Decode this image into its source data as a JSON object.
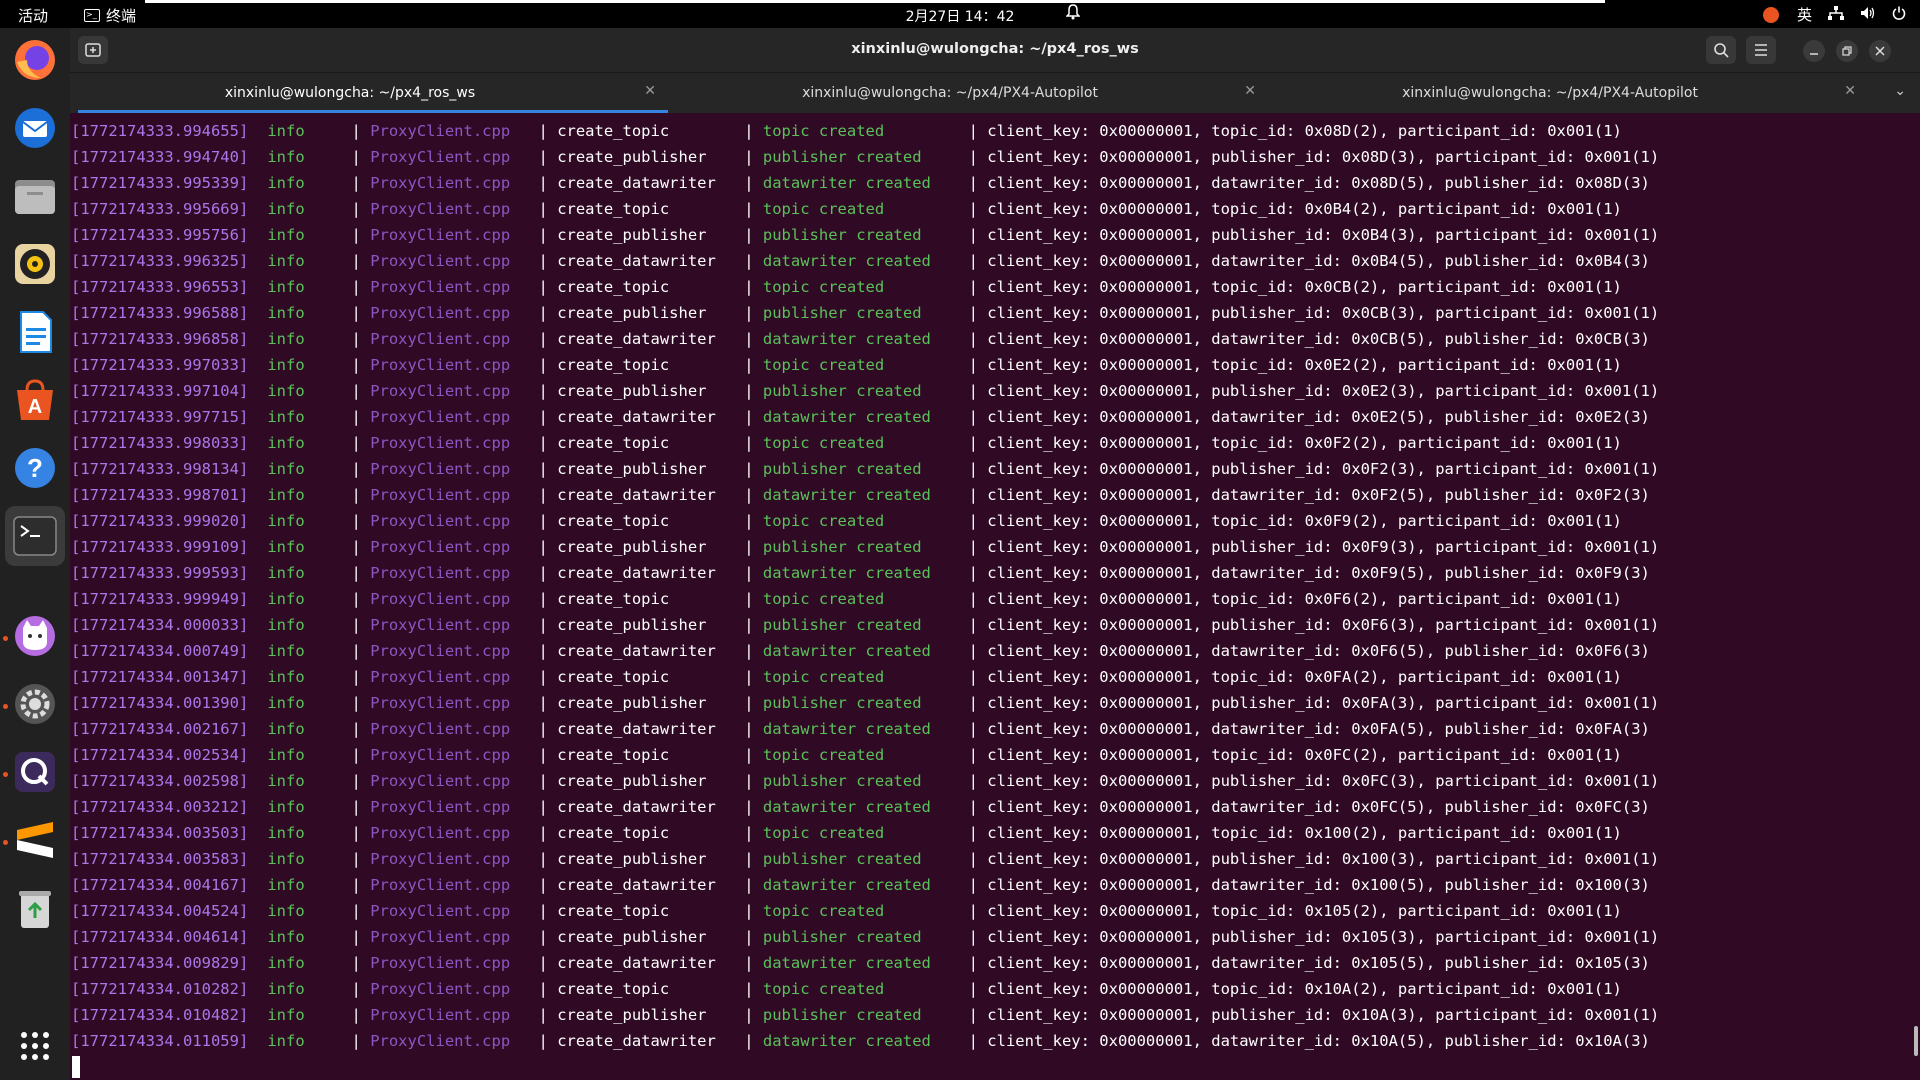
{
  "topbar": {
    "activities": "活动",
    "app_name": "终端",
    "clock": "2月27日 14：42",
    "input_method": "英"
  },
  "window": {
    "title": "xinxinlu@wulongcha: ~/px4_ros_ws",
    "tabs": [
      {
        "label": "xinxinlu@wulongcha: ~/px4_ros_ws",
        "active": true
      },
      {
        "label": "xinxinlu@wulongcha: ~/px4/PX4-Autopilot",
        "active": false
      },
      {
        "label": "xinxinlu@wulongcha: ~/px4/PX4-Autopilot",
        "active": false
      }
    ]
  },
  "dock": {
    "items": [
      "firefox-icon",
      "thunderbird-icon",
      "files-icon",
      "rhythmbox-icon",
      "libreoffice-writer-icon",
      "app-center-icon",
      "help-icon",
      "terminal-icon",
      "cat-app-icon",
      "settings-icon",
      "qgroundcontrol-icon",
      "sublime-text-icon",
      "trash-icon",
      "show-apps-icon"
    ]
  },
  "colors": {
    "terminal_bg": "#300a24",
    "timestamp": "#ab76ea",
    "level": "#5ac15a",
    "file": "#8e55c4",
    "accent": "#3584e4"
  },
  "log": [
    {
      "ts": "[1772174333.994655]",
      "level": "info",
      "file": "ProxyClient.cpp",
      "func": "create_topic",
      "status": "topic created",
      "details": "client_key: 0x00000001, topic_id: 0x08D(2), participant_id: 0x001(1)"
    },
    {
      "ts": "[1772174333.994740]",
      "level": "info",
      "file": "ProxyClient.cpp",
      "func": "create_publisher",
      "status": "publisher created",
      "details": "client_key: 0x00000001, publisher_id: 0x08D(3), participant_id: 0x001(1)"
    },
    {
      "ts": "[1772174333.995339]",
      "level": "info",
      "file": "ProxyClient.cpp",
      "func": "create_datawriter",
      "status": "datawriter created",
      "details": "client_key: 0x00000001, datawriter_id: 0x08D(5), publisher_id: 0x08D(3)"
    },
    {
      "ts": "[1772174333.995669]",
      "level": "info",
      "file": "ProxyClient.cpp",
      "func": "create_topic",
      "status": "topic created",
      "details": "client_key: 0x00000001, topic_id: 0x0B4(2), participant_id: 0x001(1)"
    },
    {
      "ts": "[1772174333.995756]",
      "level": "info",
      "file": "ProxyClient.cpp",
      "func": "create_publisher",
      "status": "publisher created",
      "details": "client_key: 0x00000001, publisher_id: 0x0B4(3), participant_id: 0x001(1)"
    },
    {
      "ts": "[1772174333.996325]",
      "level": "info",
      "file": "ProxyClient.cpp",
      "func": "create_datawriter",
      "status": "datawriter created",
      "details": "client_key: 0x00000001, datawriter_id: 0x0B4(5), publisher_id: 0x0B4(3)"
    },
    {
      "ts": "[1772174333.996553]",
      "level": "info",
      "file": "ProxyClient.cpp",
      "func": "create_topic",
      "status": "topic created",
      "details": "client_key: 0x00000001, topic_id: 0x0CB(2), participant_id: 0x001(1)"
    },
    {
      "ts": "[1772174333.996588]",
      "level": "info",
      "file": "ProxyClient.cpp",
      "func": "create_publisher",
      "status": "publisher created",
      "details": "client_key: 0x00000001, publisher_id: 0x0CB(3), participant_id: 0x001(1)"
    },
    {
      "ts": "[1772174333.996858]",
      "level": "info",
      "file": "ProxyClient.cpp",
      "func": "create_datawriter",
      "status": "datawriter created",
      "details": "client_key: 0x00000001, datawriter_id: 0x0CB(5), publisher_id: 0x0CB(3)"
    },
    {
      "ts": "[1772174333.997033]",
      "level": "info",
      "file": "ProxyClient.cpp",
      "func": "create_topic",
      "status": "topic created",
      "details": "client_key: 0x00000001, topic_id: 0x0E2(2), participant_id: 0x001(1)"
    },
    {
      "ts": "[1772174333.997104]",
      "level": "info",
      "file": "ProxyClient.cpp",
      "func": "create_publisher",
      "status": "publisher created",
      "details": "client_key: 0x00000001, publisher_id: 0x0E2(3), participant_id: 0x001(1)"
    },
    {
      "ts": "[1772174333.997715]",
      "level": "info",
      "file": "ProxyClient.cpp",
      "func": "create_datawriter",
      "status": "datawriter created",
      "details": "client_key: 0x00000001, datawriter_id: 0x0E2(5), publisher_id: 0x0E2(3)"
    },
    {
      "ts": "[1772174333.998033]",
      "level": "info",
      "file": "ProxyClient.cpp",
      "func": "create_topic",
      "status": "topic created",
      "details": "client_key: 0x00000001, topic_id: 0x0F2(2), participant_id: 0x001(1)"
    },
    {
      "ts": "[1772174333.998134]",
      "level": "info",
      "file": "ProxyClient.cpp",
      "func": "create_publisher",
      "status": "publisher created",
      "details": "client_key: 0x00000001, publisher_id: 0x0F2(3), participant_id: 0x001(1)"
    },
    {
      "ts": "[1772174333.998701]",
      "level": "info",
      "file": "ProxyClient.cpp",
      "func": "create_datawriter",
      "status": "datawriter created",
      "details": "client_key: 0x00000001, datawriter_id: 0x0F2(5), publisher_id: 0x0F2(3)"
    },
    {
      "ts": "[1772174333.999020]",
      "level": "info",
      "file": "ProxyClient.cpp",
      "func": "create_topic",
      "status": "topic created",
      "details": "client_key: 0x00000001, topic_id: 0x0F9(2), participant_id: 0x001(1)"
    },
    {
      "ts": "[1772174333.999109]",
      "level": "info",
      "file": "ProxyClient.cpp",
      "func": "create_publisher",
      "status": "publisher created",
      "details": "client_key: 0x00000001, publisher_id: 0x0F9(3), participant_id: 0x001(1)"
    },
    {
      "ts": "[1772174333.999593]",
      "level": "info",
      "file": "ProxyClient.cpp",
      "func": "create_datawriter",
      "status": "datawriter created",
      "details": "client_key: 0x00000001, datawriter_id: 0x0F9(5), publisher_id: 0x0F9(3)"
    },
    {
      "ts": "[1772174333.999949]",
      "level": "info",
      "file": "ProxyClient.cpp",
      "func": "create_topic",
      "status": "topic created",
      "details": "client_key: 0x00000001, topic_id: 0x0F6(2), participant_id: 0x001(1)"
    },
    {
      "ts": "[1772174334.000033]",
      "level": "info",
      "file": "ProxyClient.cpp",
      "func": "create_publisher",
      "status": "publisher created",
      "details": "client_key: 0x00000001, publisher_id: 0x0F6(3), participant_id: 0x001(1)"
    },
    {
      "ts": "[1772174334.000749]",
      "level": "info",
      "file": "ProxyClient.cpp",
      "func": "create_datawriter",
      "status": "datawriter created",
      "details": "client_key: 0x00000001, datawriter_id: 0x0F6(5), publisher_id: 0x0F6(3)"
    },
    {
      "ts": "[1772174334.001347]",
      "level": "info",
      "file": "ProxyClient.cpp",
      "func": "create_topic",
      "status": "topic created",
      "details": "client_key: 0x00000001, topic_id: 0x0FA(2), participant_id: 0x001(1)"
    },
    {
      "ts": "[1772174334.001390]",
      "level": "info",
      "file": "ProxyClient.cpp",
      "func": "create_publisher",
      "status": "publisher created",
      "details": "client_key: 0x00000001, publisher_id: 0x0FA(3), participant_id: 0x001(1)"
    },
    {
      "ts": "[1772174334.002167]",
      "level": "info",
      "file": "ProxyClient.cpp",
      "func": "create_datawriter",
      "status": "datawriter created",
      "details": "client_key: 0x00000001, datawriter_id: 0x0FA(5), publisher_id: 0x0FA(3)"
    },
    {
      "ts": "[1772174334.002534]",
      "level": "info",
      "file": "ProxyClient.cpp",
      "func": "create_topic",
      "status": "topic created",
      "details": "client_key: 0x00000001, topic_id: 0x0FC(2), participant_id: 0x001(1)"
    },
    {
      "ts": "[1772174334.002598]",
      "level": "info",
      "file": "ProxyClient.cpp",
      "func": "create_publisher",
      "status": "publisher created",
      "details": "client_key: 0x00000001, publisher_id: 0x0FC(3), participant_id: 0x001(1)"
    },
    {
      "ts": "[1772174334.003212]",
      "level": "info",
      "file": "ProxyClient.cpp",
      "func": "create_datawriter",
      "status": "datawriter created",
      "details": "client_key: 0x00000001, datawriter_id: 0x0FC(5), publisher_id: 0x0FC(3)"
    },
    {
      "ts": "[1772174334.003503]",
      "level": "info",
      "file": "ProxyClient.cpp",
      "func": "create_topic",
      "status": "topic created",
      "details": "client_key: 0x00000001, topic_id: 0x100(2), participant_id: 0x001(1)"
    },
    {
      "ts": "[1772174334.003583]",
      "level": "info",
      "file": "ProxyClient.cpp",
      "func": "create_publisher",
      "status": "publisher created",
      "details": "client_key: 0x00000001, publisher_id: 0x100(3), participant_id: 0x001(1)"
    },
    {
      "ts": "[1772174334.004167]",
      "level": "info",
      "file": "ProxyClient.cpp",
      "func": "create_datawriter",
      "status": "datawriter created",
      "details": "client_key: 0x00000001, datawriter_id: 0x100(5), publisher_id: 0x100(3)"
    },
    {
      "ts": "[1772174334.004524]",
      "level": "info",
      "file": "ProxyClient.cpp",
      "func": "create_topic",
      "status": "topic created",
      "details": "client_key: 0x00000001, topic_id: 0x105(2), participant_id: 0x001(1)"
    },
    {
      "ts": "[1772174334.004614]",
      "level": "info",
      "file": "ProxyClient.cpp",
      "func": "create_publisher",
      "status": "publisher created",
      "details": "client_key: 0x00000001, publisher_id: 0x105(3), participant_id: 0x001(1)"
    },
    {
      "ts": "[1772174334.009829]",
      "level": "info",
      "file": "ProxyClient.cpp",
      "func": "create_datawriter",
      "status": "datawriter created",
      "details": "client_key: 0x00000001, datawriter_id: 0x105(5), publisher_id: 0x105(3)"
    },
    {
      "ts": "[1772174334.010282]",
      "level": "info",
      "file": "ProxyClient.cpp",
      "func": "create_topic",
      "status": "topic created",
      "details": "client_key: 0x00000001, topic_id: 0x10A(2), participant_id: 0x001(1)"
    },
    {
      "ts": "[1772174334.010482]",
      "level": "info",
      "file": "ProxyClient.cpp",
      "func": "create_publisher",
      "status": "publisher created",
      "details": "client_key: 0x00000001, publisher_id: 0x10A(3), participant_id: 0x001(1)"
    },
    {
      "ts": "[1772174334.011059]",
      "level": "info",
      "file": "ProxyClient.cpp",
      "func": "create_datawriter",
      "status": "datawriter created",
      "details": "client_key: 0x00000001, datawriter_id: 0x10A(5), publisher_id: 0x10A(3)"
    }
  ]
}
